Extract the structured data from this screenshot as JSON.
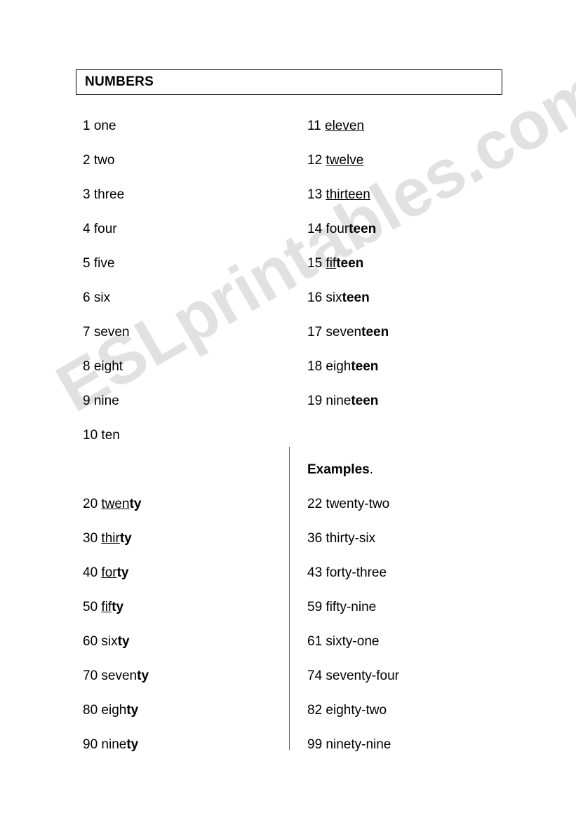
{
  "document": {
    "title": "NUMBERS",
    "watermark": "ESLprintables.com"
  },
  "columns": {
    "ones": [
      {
        "num": "1",
        "word": "one"
      },
      {
        "num": "2",
        "word": "two"
      },
      {
        "num": "3",
        "word": "three"
      },
      {
        "num": "4",
        "word": "four"
      },
      {
        "num": "5",
        "word": "five"
      },
      {
        "num": "6",
        "word": "six"
      },
      {
        "num": "7",
        "word": "seven"
      },
      {
        "num": "8",
        "word": "eight"
      },
      {
        "num": "9",
        "word": "nine"
      },
      {
        "num": "10",
        "word": "ten"
      }
    ],
    "teens": [
      {
        "num": "11",
        "plain": "",
        "marked": "eleven",
        "style": "underline"
      },
      {
        "num": "12",
        "plain": "",
        "marked": "twelve",
        "style": "underline"
      },
      {
        "num": "13",
        "plain": "",
        "marked": "thirteen",
        "style": "underline"
      },
      {
        "num": "14",
        "plain": "four",
        "marked": "teen",
        "style": "bold"
      },
      {
        "num": "15",
        "plain": "",
        "marked": "fifteen",
        "style": "mixed"
      },
      {
        "num": "16",
        "plain": "six",
        "marked": "teen",
        "style": "bold"
      },
      {
        "num": "17",
        "plain": "seven",
        "marked": "teen",
        "style": "bold"
      },
      {
        "num": "18",
        "plain": "eigh",
        "marked": "teen",
        "style": "bold"
      },
      {
        "num": "19",
        "plain": "nine",
        "marked": "teen",
        "style": "bold"
      }
    ],
    "tens": [
      {
        "num": "20",
        "plain": "twen",
        "marked": "ty",
        "style": "mixed"
      },
      {
        "num": "30",
        "plain": "thir",
        "marked": "ty",
        "style": "mixed"
      },
      {
        "num": "40",
        "plain": "for",
        "marked": "ty",
        "style": "mixed"
      },
      {
        "num": "50",
        "plain": "fif",
        "marked": "ty",
        "style": "mixed"
      },
      {
        "num": "60",
        "plain": "six",
        "marked": "ty",
        "style": "bold"
      },
      {
        "num": "70",
        "plain": "seven",
        "marked": "ty",
        "style": "bold"
      },
      {
        "num": "80",
        "plain": "eigh",
        "marked": "ty",
        "style": "bold"
      },
      {
        "num": "90",
        "plain": "nine",
        "marked": "ty",
        "style": "bold"
      }
    ],
    "examples_heading": "Examples",
    "examples_heading_punct": ".",
    "examples": [
      {
        "num": "22",
        "word": "twenty-two"
      },
      {
        "num": "36",
        "word": "thirty-six"
      },
      {
        "num": "43",
        "word": "forty-three"
      },
      {
        "num": "59",
        "word": "fifty-nine"
      },
      {
        "num": "61",
        "word": "sixty-one"
      },
      {
        "num": "74",
        "word": "seventy-four"
      },
      {
        "num": "82",
        "word": "eighty-two"
      },
      {
        "num": "99",
        "word": "ninety-nine"
      }
    ]
  }
}
